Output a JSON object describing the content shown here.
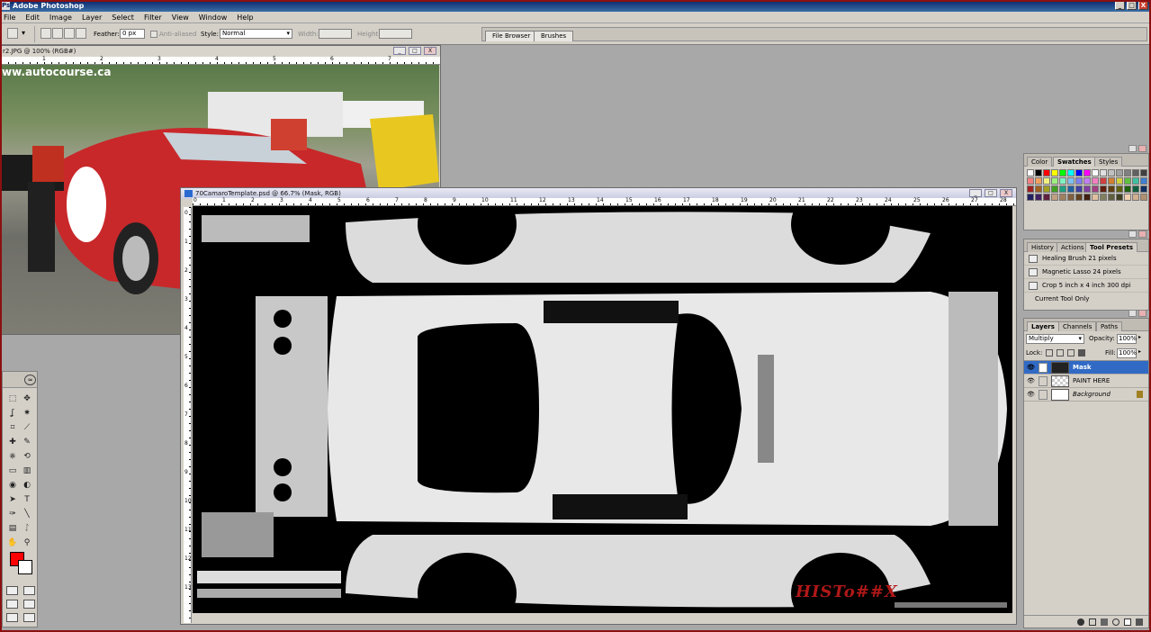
{
  "app": {
    "title": "Adobe Photoshop",
    "icon": "photoshop-icon",
    "window_buttons": [
      "_",
      "□",
      "X"
    ]
  },
  "menu": [
    "File",
    "Edit",
    "Image",
    "Layer",
    "Select",
    "Filter",
    "View",
    "Window",
    "Help"
  ],
  "options_bar": {
    "feather_label": "Feather:",
    "feather_value": "0 px",
    "anti_aliased_label": "Anti-aliased",
    "style_label": "Style:",
    "style_value": "Normal",
    "width_label": "Width:",
    "height_label": "Height:"
  },
  "palette_well": {
    "tabs": [
      "File Browser",
      "Brushes"
    ]
  },
  "photo_doc": {
    "title": "r2.JPG @ 100% (RGB#)",
    "ruler_numbers": [
      "1",
      "2",
      "3",
      "4",
      "5",
      "6",
      "7"
    ],
    "watermark": "ww.autocourse.ca",
    "buttons": [
      "_",
      "□",
      "X"
    ]
  },
  "template_doc": {
    "title": "70CamaroTemplate.psd @ 66.7% (Mask, RGB)",
    "ruler_numbers": [
      "0",
      "1",
      "2",
      "3",
      "4",
      "5",
      "6",
      "7",
      "8",
      "9",
      "10",
      "11",
      "12",
      "13",
      "14",
      "15",
      "16",
      "17",
      "18",
      "19",
      "20",
      "21",
      "22",
      "23",
      "24",
      "25",
      "26",
      "27",
      "28"
    ],
    "ruler_numbers_vertical": [
      "0",
      "1",
      "2",
      "3",
      "4",
      "5",
      "6",
      "7",
      "8",
      "9",
      "10",
      "11",
      "12",
      "13"
    ],
    "watermark": "HISTo##X",
    "buttons": [
      "_",
      "□",
      "X"
    ]
  },
  "color_palette": {
    "tabs": [
      "Color",
      "Swatches",
      "Styles"
    ],
    "active_tab": "Swatches",
    "swatch_colors": [
      "#ffffff",
      "#000000",
      "#ff0000",
      "#ffff00",
      "#00ff00",
      "#00ffff",
      "#0000ff",
      "#ff00ff",
      "#ffffff",
      "#e0e0e0",
      "#c0c0c0",
      "#a0a0a0",
      "#808080",
      "#606060",
      "#404040",
      "#f08080",
      "#f0a060",
      "#f0f080",
      "#a0f080",
      "#80f0c0",
      "#80c0f0",
      "#8080f0",
      "#c080f0",
      "#f080c0",
      "#d04040",
      "#d08030",
      "#d0d040",
      "#60c040",
      "#40c0a0",
      "#4080d0",
      "#a02020",
      "#a06020",
      "#a0a020",
      "#40a020",
      "#20a080",
      "#2060a0",
      "#4040a0",
      "#8040a0",
      "#a04080",
      "#602010",
      "#604010",
      "#606010",
      "#206010",
      "#106040",
      "#103060",
      "#202060",
      "#402060",
      "#602040",
      "#c0a080",
      "#a08060",
      "#806040",
      "#604020",
      "#402010",
      "#e0c0a0",
      "#808060",
      "#606040",
      "#404020",
      "#f0d0b0",
      "#d0b090",
      "#b09070"
    ]
  },
  "presets_palette": {
    "tabs": [
      "History",
      "Actions",
      "Tool Presets"
    ],
    "active_tab": "Tool Presets",
    "items": [
      "Healing Brush 21 pixels",
      "Magnetic Lasso 24 pixels",
      "Crop 5 inch x 4 inch 300 dpi"
    ],
    "current_tool_only": "Current Tool Only"
  },
  "layers_palette": {
    "tabs": [
      "Layers",
      "Channels",
      "Paths"
    ],
    "active_tab": "Layers",
    "blend_mode": "Multiply",
    "opacity_label": "Opacity:",
    "opacity_value": "100%",
    "lock_label": "Lock:",
    "fill_label": "Fill:",
    "fill_value": "100%",
    "layers": [
      {
        "name": "Mask",
        "selected": true
      },
      {
        "name": "PAINT HERE",
        "selected": false
      },
      {
        "name": "Background",
        "selected": false,
        "locked": true
      }
    ]
  },
  "toolbox": {
    "foreground_color": "#ff0000",
    "background_color": "#ffffff",
    "tools": [
      "marquee-icon",
      "move-icon",
      "lasso-icon",
      "magic-wand-icon",
      "crop-icon",
      "slice-icon",
      "healing-brush-icon",
      "brush-icon",
      "clone-stamp-icon",
      "history-brush-icon",
      "eraser-icon",
      "gradient-icon",
      "blur-icon",
      "dodge-icon",
      "path-selection-icon",
      "type-icon",
      "pen-icon",
      "line-icon",
      "notes-icon",
      "eyedropper-icon",
      "hand-icon",
      "zoom-icon"
    ],
    "tool_glyphs": [
      "⬚",
      "✥",
      "ʆ",
      "✷",
      "⌗",
      "⟋",
      "✚",
      "✎",
      "⎈",
      "⟲",
      "▭",
      "▥",
      "◉",
      "◐",
      "➤",
      "T",
      "✑",
      "╲",
      "▤",
      "ᛇ",
      "✋",
      "⚲"
    ]
  },
  "colors": {
    "title_bar": "#0a246a",
    "chrome": "#d4d0c8",
    "workspace": "#a8a8a8",
    "selection": "#316ac5",
    "screen_border": "#8b1010"
  }
}
